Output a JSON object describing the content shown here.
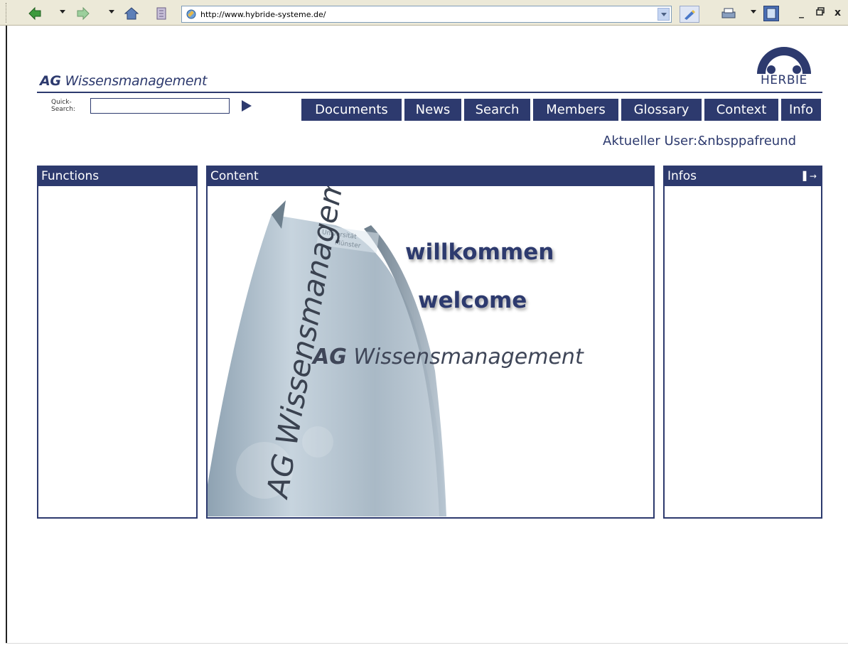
{
  "browser": {
    "url": "http://www.hybride-systeme.de/"
  },
  "icons": {
    "back": "back-arrow-icon",
    "forward": "forward-arrow-icon",
    "home": "home-icon",
    "history": "history-icon",
    "favicon": "favicon-icon",
    "edit": "edit-icon",
    "print": "print-icon",
    "page": "page-icon",
    "minimize": "minimize-icon",
    "restore": "restore-icon",
    "close": "close-icon"
  },
  "window_controls": {
    "minimize": "_",
    "restore": "Ǿ",
    "close": "x"
  },
  "header": {
    "brand_bold": "AG",
    "brand_rest": " Wissensmanagement",
    "logo_text": "HERBIE"
  },
  "quicksearch": {
    "label_line1": "Quick-",
    "label_line2": "Search:",
    "value": ""
  },
  "nav": [
    {
      "label": "Documents"
    },
    {
      "label": "News"
    },
    {
      "label": "Search"
    },
    {
      "label": "Members"
    },
    {
      "label": "Glossary"
    },
    {
      "label": "Context"
    },
    {
      "label": "Info"
    }
  ],
  "user_line": "Aktueller User:&nbsppafreund",
  "panels": {
    "functions": "Functions",
    "content": "Content",
    "infos": "Infos",
    "infos_icon": "▌→"
  },
  "hero": {
    "greeting_de": "willkommen",
    "greeting_en": "welcome",
    "brand_bold": "AG",
    "brand_rest": " Wissensmanagement",
    "pillar_text": "AG Wissensmanagement",
    "plate_line1": "Universität",
    "plate_line2": "Münster"
  },
  "colors": {
    "brand_navy": "#2d3a6e",
    "toolbar_bg": "#ece9d8"
  }
}
